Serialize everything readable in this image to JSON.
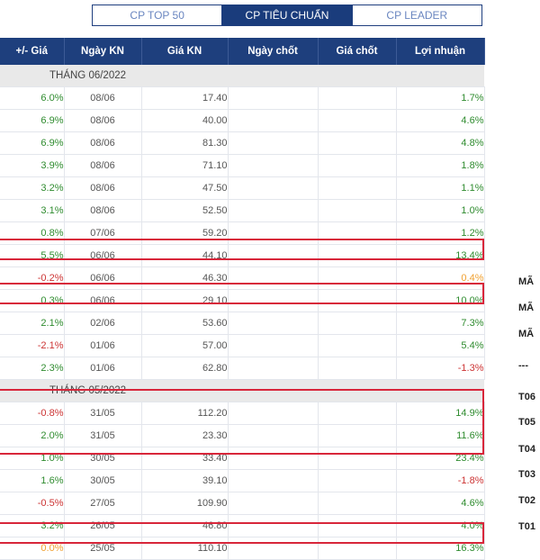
{
  "tabs": [
    {
      "label": "CP TOP 50",
      "active": false
    },
    {
      "label": "CP TIÊU CHUẨN",
      "active": true
    },
    {
      "label": "CP LEADER",
      "active": false
    }
  ],
  "columns": [
    "+/- Giá",
    "Ngày KN",
    "Giá KN",
    "Ngày chốt",
    "Giá chốt",
    "Lợi nhuận"
  ],
  "groups": [
    {
      "month": "THÁNG 06/2022",
      "rows": [
        {
          "change": "6.0%",
          "change_sign": "pos",
          "date": "08/06",
          "price": "17.40",
          "close_date": "",
          "close_price": "",
          "profit": "1.7%",
          "profit_sign": "pos"
        },
        {
          "change": "6.9%",
          "change_sign": "pos",
          "date": "08/06",
          "price": "40.00",
          "close_date": "",
          "close_price": "",
          "profit": "4.6%",
          "profit_sign": "pos"
        },
        {
          "change": "6.9%",
          "change_sign": "pos",
          "date": "08/06",
          "price": "81.30",
          "close_date": "",
          "close_price": "",
          "profit": "4.8%",
          "profit_sign": "pos"
        },
        {
          "change": "3.9%",
          "change_sign": "pos",
          "date": "08/06",
          "price": "71.10",
          "close_date": "",
          "close_price": "",
          "profit": "1.8%",
          "profit_sign": "pos"
        },
        {
          "change": "3.2%",
          "change_sign": "pos",
          "date": "08/06",
          "price": "47.50",
          "close_date": "",
          "close_price": "",
          "profit": "1.1%",
          "profit_sign": "pos"
        },
        {
          "change": "3.1%",
          "change_sign": "pos",
          "date": "08/06",
          "price": "52.50",
          "close_date": "",
          "close_price": "",
          "profit": "1.0%",
          "profit_sign": "pos"
        },
        {
          "change": "0.8%",
          "change_sign": "pos",
          "date": "07/06",
          "price": "59.20",
          "close_date": "",
          "close_price": "",
          "profit": "1.2%",
          "profit_sign": "pos"
        },
        {
          "change": "5.5%",
          "change_sign": "pos",
          "date": "06/06",
          "price": "44.10",
          "close_date": "",
          "close_price": "",
          "profit": "13.4%",
          "profit_sign": "pos"
        },
        {
          "change": "-0.2%",
          "change_sign": "neg",
          "date": "06/06",
          "price": "46.30",
          "close_date": "",
          "close_price": "",
          "profit": "0.4%",
          "profit_sign": "zero"
        },
        {
          "change": "0.3%",
          "change_sign": "pos",
          "date": "06/06",
          "price": "29.10",
          "close_date": "",
          "close_price": "",
          "profit": "10.0%",
          "profit_sign": "pos"
        },
        {
          "change": "2.1%",
          "change_sign": "pos",
          "date": "02/06",
          "price": "53.60",
          "close_date": "",
          "close_price": "",
          "profit": "7.3%",
          "profit_sign": "pos"
        },
        {
          "change": "-2.1%",
          "change_sign": "neg",
          "date": "01/06",
          "price": "57.00",
          "close_date": "",
          "close_price": "",
          "profit": "5.4%",
          "profit_sign": "pos"
        },
        {
          "change": "2.3%",
          "change_sign": "pos",
          "date": "01/06",
          "price": "62.80",
          "close_date": "",
          "close_price": "",
          "profit": "-1.3%",
          "profit_sign": "neg"
        }
      ]
    },
    {
      "month": "THÁNG 05/2022",
      "rows": [
        {
          "change": "-0.8%",
          "change_sign": "neg",
          "date": "31/05",
          "price": "112.20",
          "close_date": "",
          "close_price": "",
          "profit": "14.9%",
          "profit_sign": "pos"
        },
        {
          "change": "2.0%",
          "change_sign": "pos",
          "date": "31/05",
          "price": "23.30",
          "close_date": "",
          "close_price": "",
          "profit": "11.6%",
          "profit_sign": "pos"
        },
        {
          "change": "1.0%",
          "change_sign": "pos",
          "date": "30/05",
          "price": "33.40",
          "close_date": "",
          "close_price": "",
          "profit": "23.4%",
          "profit_sign": "pos"
        },
        {
          "change": "1.6%",
          "change_sign": "pos",
          "date": "30/05",
          "price": "39.10",
          "close_date": "",
          "close_price": "",
          "profit": "-1.8%",
          "profit_sign": "neg"
        },
        {
          "change": "-0.5%",
          "change_sign": "neg",
          "date": "27/05",
          "price": "109.90",
          "close_date": "",
          "close_price": "",
          "profit": "4.6%",
          "profit_sign": "pos"
        },
        {
          "change": "3.2%",
          "change_sign": "pos",
          "date": "26/05",
          "price": "46.80",
          "close_date": "",
          "close_price": "",
          "profit": "4.0%",
          "profit_sign": "pos"
        },
        {
          "change": "0.0%",
          "change_sign": "zero",
          "date": "25/05",
          "price": "110.10",
          "close_date": "",
          "close_price": "",
          "profit": "16.3%",
          "profit_sign": "pos"
        }
      ]
    }
  ],
  "side_labels": [
    "MÃ",
    "MÃ",
    "MÃ",
    "---",
    "T06",
    "T05",
    "T04",
    "T03",
    "T02",
    "T01"
  ],
  "colors": {
    "header_bg": "#1e3f7d",
    "positive": "#2e8b2e",
    "negative": "#cc3333",
    "neutral_orange": "#f0a030",
    "highlight": "#d8263a"
  }
}
